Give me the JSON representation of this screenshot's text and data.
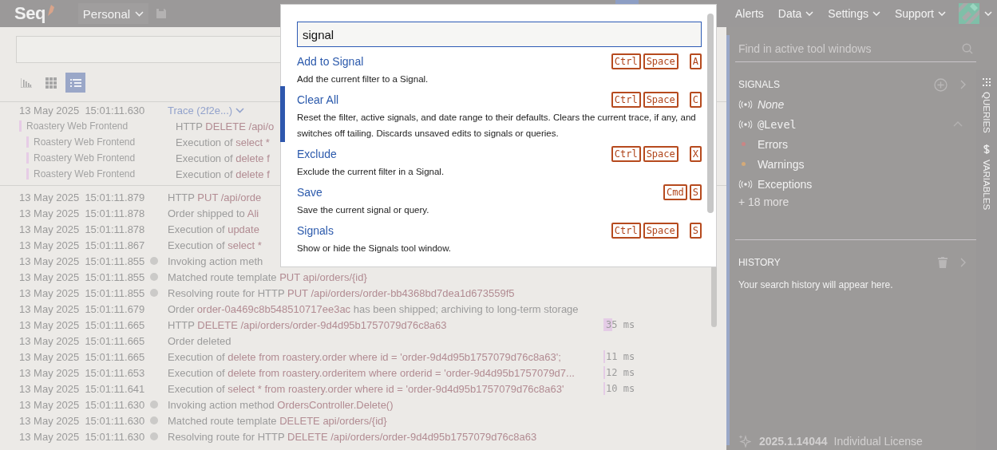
{
  "top_bar": {
    "logo": "Seq",
    "workspace": "Personal",
    "nav": [
      {
        "label": "Alerts",
        "has_menu": false
      },
      {
        "label": "Data",
        "has_menu": true
      },
      {
        "label": "Settings",
        "has_menu": true
      },
      {
        "label": "Support",
        "has_menu": true
      }
    ]
  },
  "view_modes": [
    {
      "kind": "chart",
      "selected": false
    },
    {
      "kind": "grid",
      "selected": false
    },
    {
      "kind": "list",
      "selected": true
    }
  ],
  "trace": {
    "timestamp": "13 May 2025  15:01:11.630",
    "label": "Trace (2f2e...)",
    "spans": [
      {
        "service": "Roastery Web Frontend",
        "message": [
          {
            "text": "HTTP ",
            "highlight": false
          },
          {
            "text": "DELETE",
            "highlight": true
          },
          {
            "text": " /api/o",
            "highlight": true
          }
        ],
        "children": [
          {
            "service": "Roastery Web Frontend",
            "message": [
              {
                "text": "Execution of ",
                "highlight": false
              },
              {
                "text": "select *",
                "highlight": true
              }
            ]
          },
          {
            "service": "Roastery Web Frontend",
            "message": [
              {
                "text": "Execution of ",
                "highlight": false
              },
              {
                "text": "delete f",
                "highlight": true
              }
            ]
          },
          {
            "service": "Roastery Web Frontend",
            "message": [
              {
                "text": "Execution of ",
                "highlight": false
              },
              {
                "text": "delete f",
                "highlight": true
              }
            ]
          }
        ]
      }
    ]
  },
  "events": [
    {
      "timestamp": "13 May 2025  15:01:11.879",
      "marker": false,
      "message": [
        {
          "text": "HTTP ",
          "highlight": false
        },
        {
          "text": "PUT",
          "highlight": true
        },
        {
          "text": " /api/orde",
          "highlight": true
        }
      ]
    },
    {
      "timestamp": "13 May 2025  15:01:11.878",
      "marker": false,
      "message": [
        {
          "text": "Order shipped to ",
          "highlight": false
        },
        {
          "text": "Ali",
          "highlight": true
        }
      ]
    },
    {
      "timestamp": "13 May 2025  15:01:11.878",
      "marker": false,
      "message": [
        {
          "text": "Execution of ",
          "highlight": false
        },
        {
          "text": "update",
          "highlight": true
        }
      ]
    },
    {
      "timestamp": "13 May 2025  15:01:11.867",
      "marker": false,
      "message": [
        {
          "text": "Execution of ",
          "highlight": false
        },
        {
          "text": "select *",
          "highlight": true
        }
      ]
    },
    {
      "timestamp": "13 May 2025  15:01:11.855",
      "marker": true,
      "message": [
        {
          "text": "Invoking action meth",
          "highlight": false
        }
      ]
    },
    {
      "timestamp": "13 May 2025  15:01:11.855",
      "marker": true,
      "message": [
        {
          "text": "Matched route template ",
          "highlight": false
        },
        {
          "text": "PUT api/orders/{id}",
          "highlight": true
        }
      ]
    },
    {
      "timestamp": "13 May 2025  15:01:11.855",
      "marker": true,
      "message": [
        {
          "text": "Resolving route for HTTP ",
          "highlight": false
        },
        {
          "text": "PUT /api/orders/order-bb4368bd7dea1d673559f5",
          "highlight": true
        }
      ]
    },
    {
      "timestamp": "13 May 2025  15:01:11.679",
      "marker": false,
      "message": [
        {
          "text": "Order ",
          "highlight": false
        },
        {
          "text": "order-0a469c8b548510717ee3ac",
          "highlight": true
        },
        {
          "text": " has been shipped; archiving to long-term storage",
          "highlight": false
        }
      ]
    },
    {
      "timestamp": "13 May 2025  15:01:11.665",
      "marker": false,
      "message": [
        {
          "text": "HTTP ",
          "highlight": false
        },
        {
          "text": "DELETE /api/orders/order-9d4d95b1757079d76c8a63",
          "highlight": true
        }
      ],
      "duration": "35 ms",
      "level": 0.35
    },
    {
      "timestamp": "13 May 2025  15:01:11.665",
      "marker": false,
      "message": [
        {
          "text": "Order deleted",
          "highlight": false
        }
      ]
    },
    {
      "timestamp": "13 May 2025  15:01:11.665",
      "marker": false,
      "message": [
        {
          "text": "Execution of ",
          "highlight": false
        },
        {
          "text": "delete from roastery.order where id = 'order-9d4d95b1757079d76c8a63';",
          "highlight": true
        }
      ],
      "duration": "11 ms",
      "level": 0.04
    },
    {
      "timestamp": "13 May 2025  15:01:11.653",
      "marker": false,
      "message": [
        {
          "text": "Execution of ",
          "highlight": false
        },
        {
          "text": "delete from roastery.orderitem where orderid = 'order-9d4d95b1757079d7...",
          "highlight": true
        }
      ],
      "duration": "12 ms",
      "level": 0.04
    },
    {
      "timestamp": "13 May 2025  15:01:11.641",
      "marker": false,
      "message": [
        {
          "text": "Execution of ",
          "highlight": false
        },
        {
          "text": "select * from roastery.order where id = 'order-9d4d95b1757079d76c8a63'",
          "highlight": true
        }
      ],
      "duration": "10 ms",
      "level": 0.04
    },
    {
      "timestamp": "13 May 2025  15:01:11.630",
      "marker": true,
      "message": [
        {
          "text": "Invoking action method ",
          "highlight": false
        },
        {
          "text": "OrdersController.Delete()",
          "highlight": true
        }
      ]
    },
    {
      "timestamp": "13 May 2025  15:01:11.630",
      "marker": true,
      "message": [
        {
          "text": "Matched route template ",
          "highlight": false
        },
        {
          "text": "DELETE api/orders/{id}",
          "highlight": true
        }
      ]
    },
    {
      "timestamp": "13 May 2025  15:01:11.630",
      "marker": true,
      "message": [
        {
          "text": "Resolving route for HTTP ",
          "highlight": false
        },
        {
          "text": "DELETE /api/orders/order-9d4d95b1757079d76c8a63",
          "highlight": true
        }
      ]
    }
  ],
  "command_palette": {
    "query": "signal",
    "commands": [
      {
        "title": "Add to Signal",
        "description": "Add the current filter to a Signal.",
        "chords": [
          [
            "Ctrl",
            "Space"
          ],
          [
            "A"
          ]
        ],
        "selected": false
      },
      {
        "title": "Clear All",
        "description": "Reset the filter, active signals, and date range to their defaults. Clears the current trace, if any, and switches off tailing. Discards unsaved edits to signals or queries.",
        "chords": [
          [
            "Ctrl",
            "Space"
          ],
          [
            "C"
          ]
        ],
        "selected": true
      },
      {
        "title": "Exclude",
        "description": "Exclude the current filter in a Signal.",
        "chords": [
          [
            "Ctrl",
            "Space"
          ],
          [
            "X"
          ]
        ],
        "selected": false
      },
      {
        "title": "Save",
        "description": "Save the current signal or query.",
        "chords": [
          [
            "Cmd",
            "S"
          ]
        ],
        "selected": false
      },
      {
        "title": "Signals",
        "description": "Show or hide the Signals tool window.",
        "chords": [
          [
            "Ctrl",
            "Space"
          ],
          [
            "S"
          ]
        ],
        "selected": false
      }
    ]
  },
  "tool_panel": {
    "search": {
      "placeholder": "Find in active tool windows"
    },
    "signals": {
      "title": "SIGNALS",
      "items": [
        {
          "kind": "none",
          "label": "None"
        },
        {
          "kind": "property",
          "label": "@Level",
          "expanded": true,
          "children": [
            {
              "label": "Errors",
              "color": "#c98585"
            },
            {
              "label": "Warnings",
              "color": "#d4aa78"
            }
          ]
        },
        {
          "kind": "signal",
          "label": "Exceptions"
        },
        {
          "kind": "more",
          "label": "+ 18 more"
        }
      ]
    },
    "history": {
      "title": "HISTORY",
      "empty_text": "Your search history will appear here."
    },
    "tabs": [
      {
        "kind": "queries",
        "label": "QUERIES"
      },
      {
        "kind": "variables",
        "label": "VARIABLES"
      }
    ],
    "footer": {
      "version": "2025.1.14044",
      "license": "Individual License"
    }
  }
}
